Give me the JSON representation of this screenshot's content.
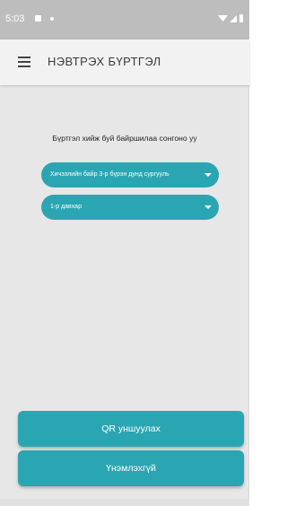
{
  "status_bar": {
    "time": "5:03",
    "icons": [
      "notification-icon",
      "dot-icon",
      "wifi-icon",
      "signal-icon",
      "battery-icon"
    ]
  },
  "app_bar": {
    "title": "НЭВТРЭХ БҮРТГЭЛ",
    "menu_icon": "hamburger-menu-icon"
  },
  "main": {
    "prompt": "Бүртгэл хийж буй байршилаа сонгоно уу",
    "location_select": {
      "value": "Хичээлийн байр 3-р бүрэн дунд сургууль"
    },
    "floor_select": {
      "value": "1-р давхар"
    }
  },
  "actions": {
    "qr_button": "QR уншуулах",
    "unregistered_button": "Үнэмлэхгүй"
  },
  "colors": {
    "accent": "#2aa6b2",
    "background": "#e7e7e7",
    "status_bar": "#bdbdbd",
    "app_bar": "#f2f2f2"
  }
}
